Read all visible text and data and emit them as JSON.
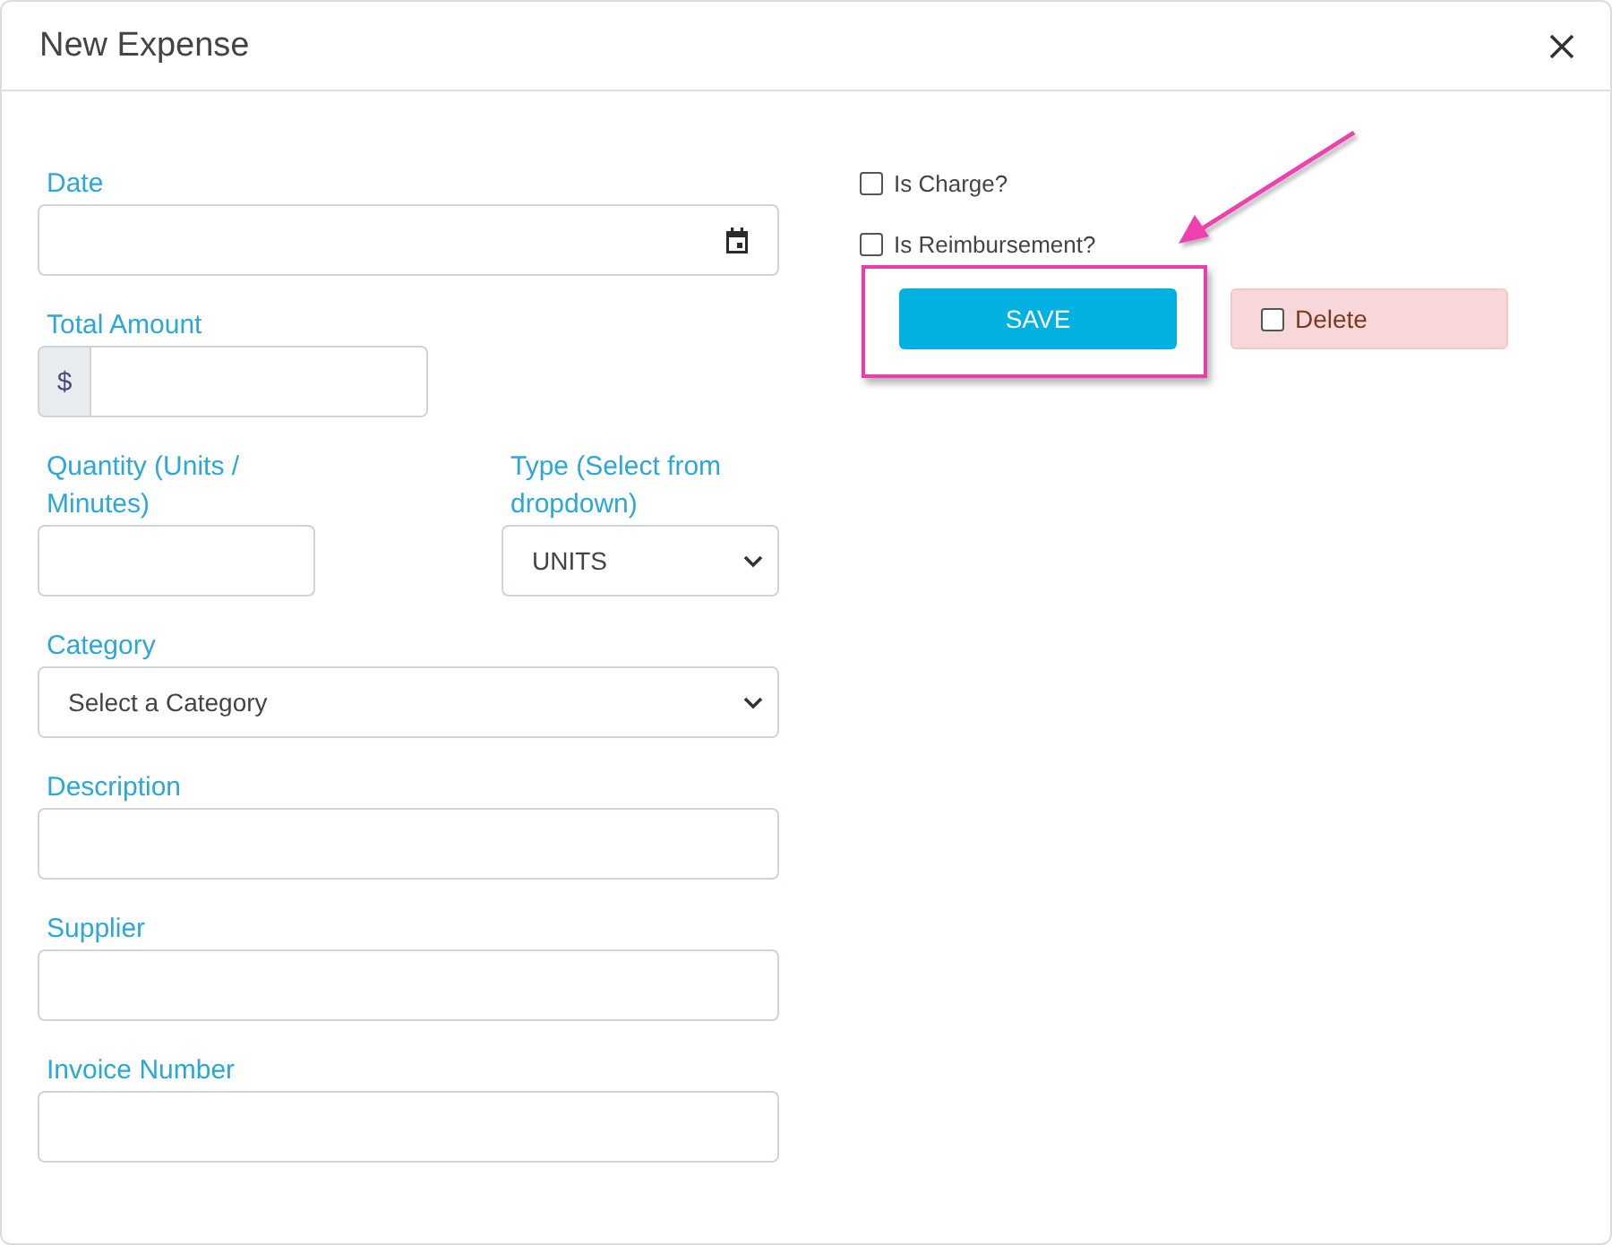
{
  "dialog": {
    "title": "New Expense"
  },
  "form": {
    "rows": [
      {
        "fields": [
          {
            "kind": "date",
            "label": "Date"
          }
        ]
      },
      {
        "fields": [
          {
            "kind": "currency",
            "label": "Total Amount",
            "prefix": "$"
          }
        ]
      },
      {
        "fields": [
          {
            "kind": "number",
            "label": "Quantity (Units / Minutes)"
          },
          {
            "kind": "select",
            "label": "Type (Select from dropdown)",
            "value": "UNITS"
          }
        ]
      },
      {
        "fields": [
          {
            "kind": "select",
            "label": "Category",
            "value": "Select a Category"
          }
        ]
      },
      {
        "fields": [
          {
            "kind": "text",
            "label": "Description"
          }
        ]
      },
      {
        "fields": [
          {
            "kind": "text",
            "label": "Supplier"
          }
        ]
      },
      {
        "fields": [
          {
            "kind": "text",
            "label": "Invoice Number"
          }
        ]
      }
    ]
  },
  "options": [
    {
      "label": "Is Charge?",
      "checked": false
    },
    {
      "label": "Is Reimbursement?",
      "checked": false
    }
  ],
  "actions": {
    "save": {
      "label": "SAVE"
    },
    "delete": {
      "label": "Delete",
      "checked": false
    }
  }
}
